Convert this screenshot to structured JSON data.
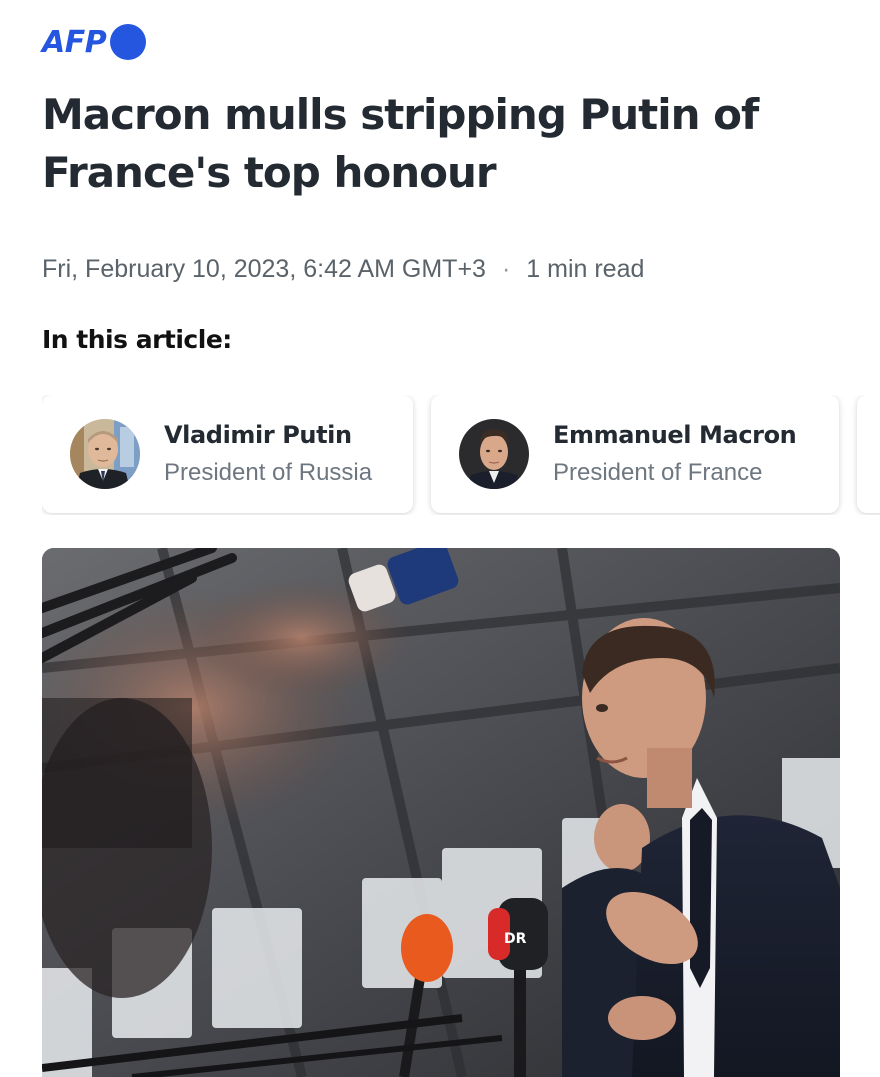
{
  "publisher": {
    "logo_text": "AFP",
    "brand_color": "#2456e0"
  },
  "headline": "Macron mulls stripping Putin of France's top honour",
  "meta": {
    "date": "Fri, February 10, 2023, 6:42 AM GMT+3",
    "separator": "·",
    "read_time": "1 min read"
  },
  "in_article": {
    "heading": "In this article:",
    "entities": [
      {
        "name": "Vladimir Putin",
        "role": "President of Russia",
        "avatar": "putin-photo"
      },
      {
        "name": "Emmanuel Macron",
        "role": "President of France",
        "avatar": "macron-photo"
      }
    ]
  },
  "hero_image": {
    "subject": "Emmanuel Macron speaking to press microphones",
    "mic_label": "DR"
  }
}
